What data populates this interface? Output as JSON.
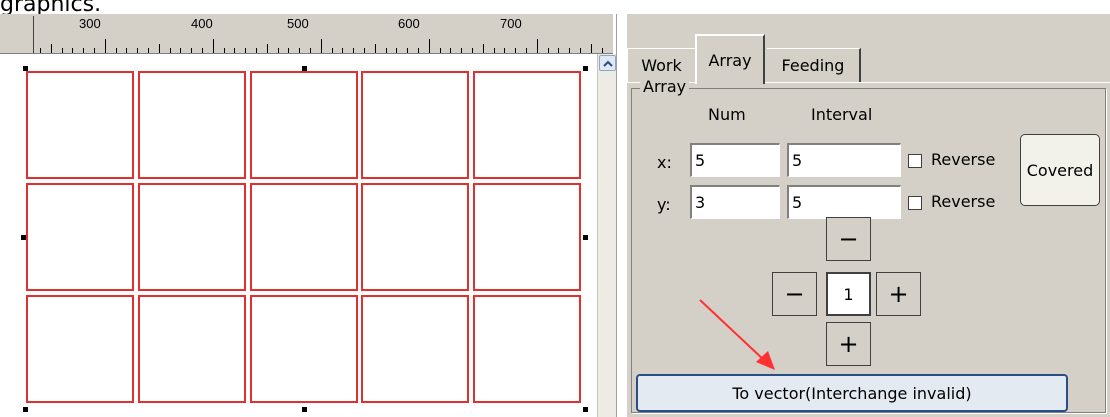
{
  "clipped_caption": "graphics.",
  "ruler": {
    "ticks": [
      "300",
      "400",
      "500",
      "600",
      "700"
    ]
  },
  "tabs": [
    {
      "label": "Work",
      "active": false
    },
    {
      "label": "Array",
      "active": true
    },
    {
      "label": "Feeding",
      "active": false
    }
  ],
  "array": {
    "group_title": "Array",
    "num_header": "Num",
    "interval_header": "Interval",
    "x_label": "x:",
    "y_label": "y:",
    "x_num": "5",
    "x_interval": "5",
    "y_num": "3",
    "y_interval": "5",
    "reverse_label": "Reverse",
    "reverse_x_checked": false,
    "reverse_y_checked": false,
    "covered_label": "Covered",
    "minus_symbol": "−",
    "plus_symbol": "+",
    "step_value": "1",
    "to_vector_label": "To vector(Interchange invalid)"
  },
  "canvas": {
    "rows": 3,
    "cols": 5,
    "cell_stroke_color": "#e03030"
  },
  "annotation_arrow_color": "#ff3030"
}
